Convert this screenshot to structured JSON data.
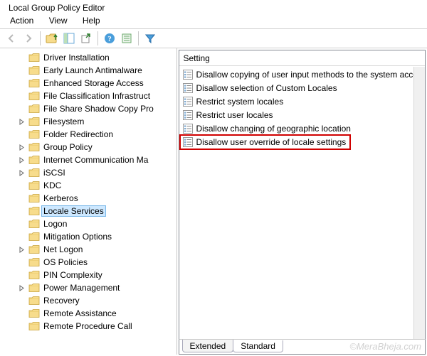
{
  "window_title": "Local Group Policy Editor",
  "menu": {
    "action": "Action",
    "view": "View",
    "help": "Help"
  },
  "toolbar_icons": [
    "back",
    "forward",
    "up",
    "show-hide-tree",
    "export",
    "help",
    "properties",
    "filter"
  ],
  "tree": [
    {
      "label": "Driver Installation",
      "expandable": false
    },
    {
      "label": "Early Launch Antimalware",
      "expandable": false
    },
    {
      "label": "Enhanced Storage Access",
      "expandable": false
    },
    {
      "label": "File Classification Infrastruct",
      "expandable": false
    },
    {
      "label": "File Share Shadow Copy Pro",
      "expandable": false
    },
    {
      "label": "Filesystem",
      "expandable": true
    },
    {
      "label": "Folder Redirection",
      "expandable": false
    },
    {
      "label": "Group Policy",
      "expandable": true
    },
    {
      "label": "Internet Communication Ma",
      "expandable": true
    },
    {
      "label": "iSCSI",
      "expandable": true
    },
    {
      "label": "KDC",
      "expandable": false
    },
    {
      "label": "Kerberos",
      "expandable": false
    },
    {
      "label": "Locale Services",
      "expandable": false,
      "selected": true
    },
    {
      "label": "Logon",
      "expandable": false
    },
    {
      "label": "Mitigation Options",
      "expandable": false
    },
    {
      "label": "Net Logon",
      "expandable": true
    },
    {
      "label": "OS Policies",
      "expandable": false
    },
    {
      "label": "PIN Complexity",
      "expandable": false
    },
    {
      "label": "Power Management",
      "expandable": true
    },
    {
      "label": "Recovery",
      "expandable": false
    },
    {
      "label": "Remote Assistance",
      "expandable": false
    },
    {
      "label": "Remote Procedure Call",
      "expandable": false
    }
  ],
  "list_header": "Setting",
  "settings": [
    "Disallow copying of user input methods to the system acco...",
    "Disallow selection of Custom Locales",
    "Restrict system locales",
    "Restrict user locales",
    "Disallow changing of geographic location",
    "Disallow user override of locale settings"
  ],
  "highlighted_setting_index": 5,
  "tabs": {
    "extended": "Extended",
    "standard": "Standard"
  },
  "watermark": "©MeraBheja.com"
}
